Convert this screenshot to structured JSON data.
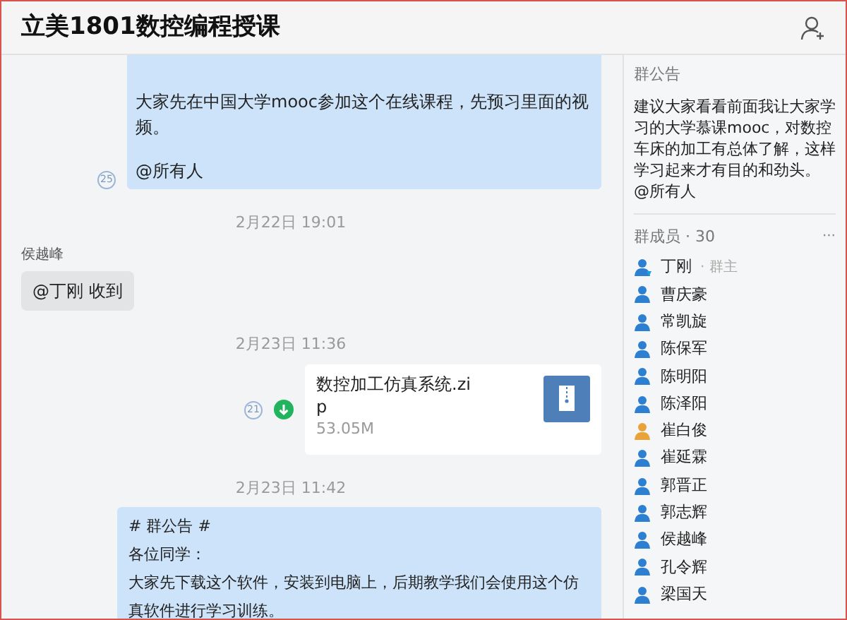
{
  "window": {
    "title": "立美1801数控编程授课"
  },
  "chat": {
    "messages": [
      {
        "kind": "own_text",
        "paragraphs": [
          "大家先在中国大学mooc参加这个在线课程，先预习里面的视频。",
          "@所有人"
        ],
        "read_count": "25"
      },
      {
        "kind": "time",
        "text": "2月22日 19:01"
      },
      {
        "kind": "incoming",
        "sender": "侯越峰",
        "text": "@丁刚 收到"
      },
      {
        "kind": "time",
        "text": "2月23日 11:36"
      },
      {
        "kind": "file",
        "name": "数控加工仿真系统.zip",
        "size": "53.05M",
        "read_count": "21"
      },
      {
        "kind": "time",
        "text": "2月23日 11:42"
      },
      {
        "kind": "notice",
        "paragraphs": [
          "# 群公告 #",
          "各位同学：",
          "大家先下载这个软件，安装到电脑上，后期教学我们会使用这个仿真软件进行学习训练。"
        ]
      }
    ]
  },
  "sidebar": {
    "announcement": {
      "heading": "群公告",
      "text": "建议大家看看前面我让大家学习的大学慕课mooc，对数控车床的加工有总体了解，这样学习起来才有目的和劲头。",
      "mention": "@所有人"
    },
    "members": {
      "heading": "群成员 · 30",
      "more": "···",
      "items": [
        {
          "name": "丁刚",
          "role": "· 群主",
          "color": "#2d7fd1"
        },
        {
          "name": "曹庆豪",
          "color": "#2d7fd1"
        },
        {
          "name": "常凯旋",
          "color": "#2d7fd1"
        },
        {
          "name": "陈保军",
          "color": "#2d7fd1"
        },
        {
          "name": "陈明阳",
          "color": "#2d7fd1"
        },
        {
          "name": "陈泽阳",
          "color": "#2d7fd1"
        },
        {
          "name": "崔白俊",
          "color": "#e8a33a"
        },
        {
          "name": "崔延霖",
          "color": "#2d7fd1"
        },
        {
          "name": "郭晋正",
          "color": "#2d7fd1"
        },
        {
          "name": "郭志辉",
          "color": "#2d7fd1"
        },
        {
          "name": "侯越峰",
          "color": "#2d7fd1"
        },
        {
          "name": "孔令辉",
          "color": "#2d7fd1"
        },
        {
          "name": "梁国天",
          "color": "#2d7fd1"
        }
      ]
    }
  }
}
